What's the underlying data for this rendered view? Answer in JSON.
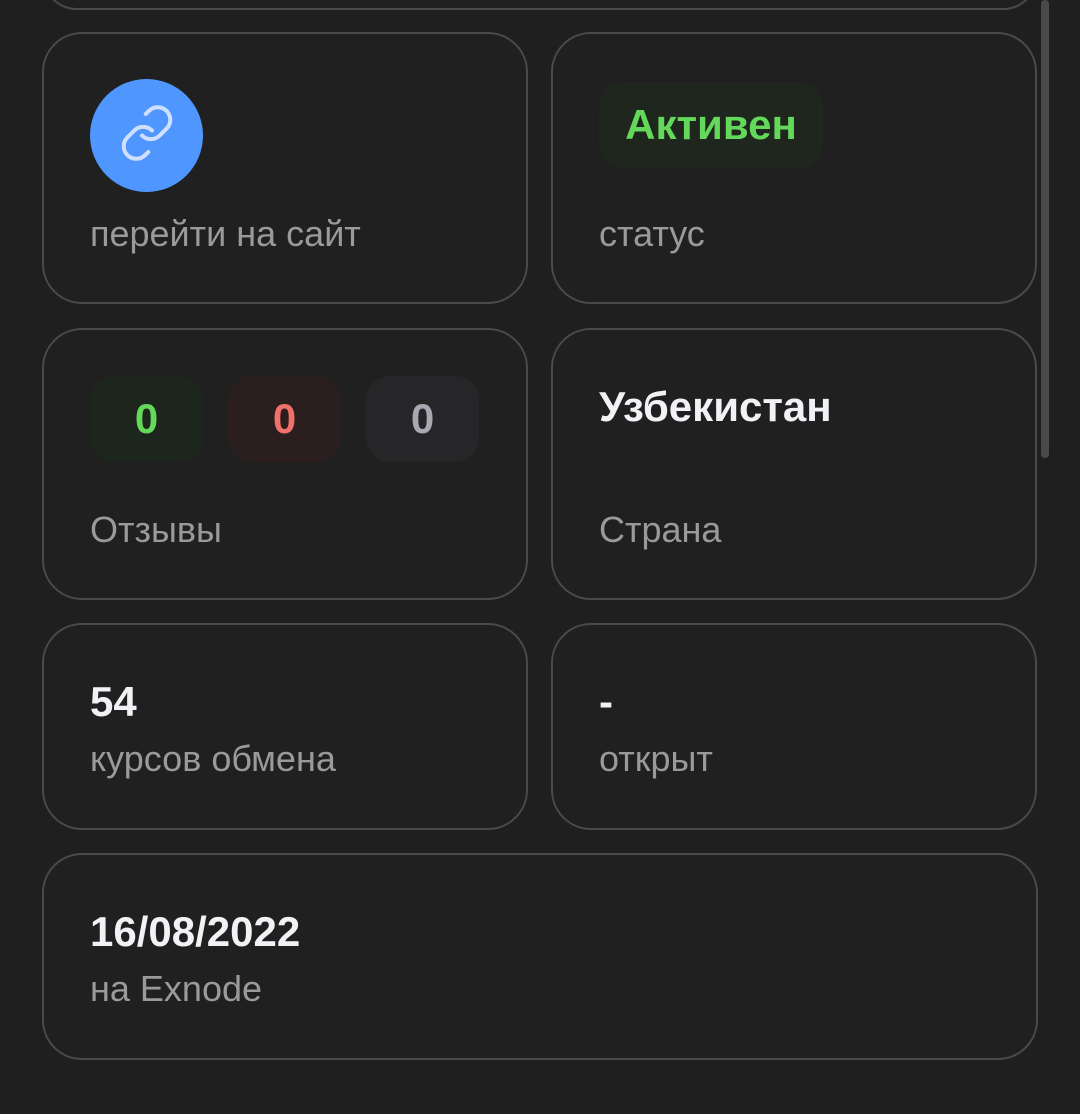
{
  "link_card": {
    "label": "перейти на сайт",
    "icon": "link-icon",
    "accent": "#4f97ff"
  },
  "status_card": {
    "badge": "Активен",
    "label": "статус",
    "badge_color": "#64d85a"
  },
  "reviews_card": {
    "positive": "0",
    "negative": "0",
    "neutral": "0",
    "label": "Отзывы"
  },
  "country_card": {
    "value": "Узбекистан",
    "label": "Страна"
  },
  "rates_card": {
    "value": "54",
    "label": "курсов обмена"
  },
  "open_card": {
    "value": "-",
    "label": "открыт"
  },
  "date_card": {
    "value": "16/08/2022",
    "label": "на Exnode"
  }
}
